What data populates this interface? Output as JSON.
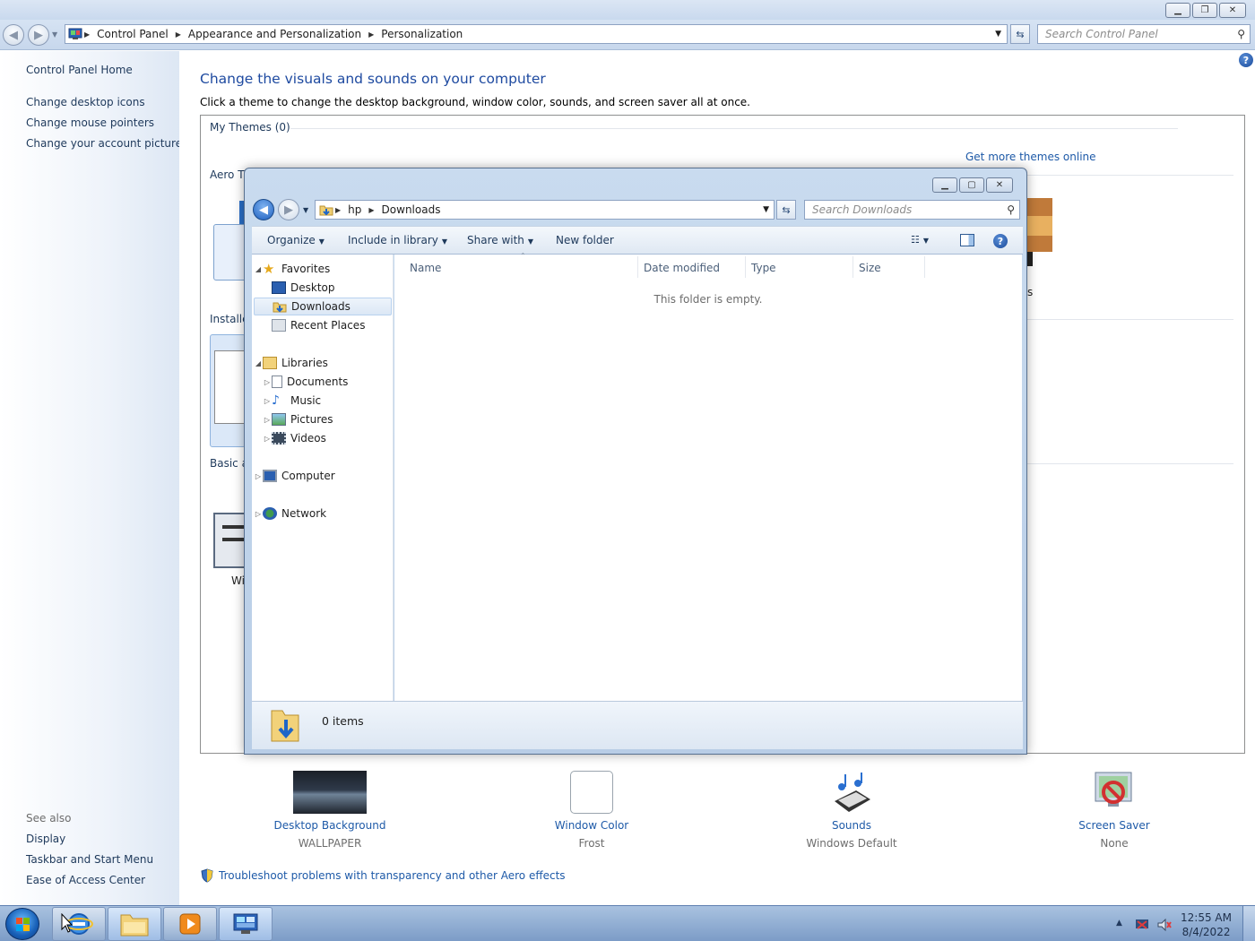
{
  "control_panel": {
    "address": {
      "crumbs": [
        "Control Panel",
        "Appearance and Personalization",
        "Personalization"
      ],
      "search_placeholder": "Search Control Panel"
    },
    "sidebar": {
      "home": "Control Panel Home",
      "links": [
        "Change desktop icons",
        "Change mouse pointers",
        "Change your account picture"
      ],
      "see_also_heading": "See also",
      "see_also": [
        "Display",
        "Taskbar and Start Menu",
        "Ease of Access Center"
      ]
    },
    "main": {
      "heading": "Change the visuals and sounds on your computer",
      "subheading": "Click a theme to change the desktop background, window color, sounds, and screen saver all at once.",
      "my_themes": "My Themes (0)",
      "get_more": "Get more themes online",
      "aero_label_partial": "Aero Th",
      "installed_label_partial": "Installe",
      "basic_label_partial": "Basic ar",
      "theme_caption_partial": "Wi",
      "right_fragment": "s"
    },
    "bottom_settings": [
      {
        "label": "Desktop Background",
        "value": "WALLPAPER"
      },
      {
        "label": "Window Color",
        "value": "Frost"
      },
      {
        "label": "Sounds",
        "value": "Windows Default"
      },
      {
        "label": "Screen Saver",
        "value": "None"
      }
    ],
    "troubleshoot": "Troubleshoot problems with transparency and other Aero effects"
  },
  "explorer": {
    "address": {
      "crumbs": [
        "hp",
        "Downloads"
      ],
      "search_placeholder": "Search Downloads"
    },
    "toolbar": {
      "organize": "Organize",
      "include": "Include in library",
      "share": "Share with",
      "new_folder": "New folder"
    },
    "nav": {
      "favorites": "Favorites",
      "desktop": "Desktop",
      "downloads": "Downloads",
      "recent": "Recent Places",
      "libraries": "Libraries",
      "documents": "Documents",
      "music": "Music",
      "pictures": "Pictures",
      "videos": "Videos",
      "computer": "Computer",
      "network": "Network"
    },
    "columns": [
      "Name",
      "Date modified",
      "Type",
      "Size"
    ],
    "empty_message": "This folder is empty.",
    "items_count": "0 items"
  },
  "taskbar": {
    "time": "12:55 AM",
    "date": "8/4/2022"
  },
  "colors": {
    "link": "#1e5aa8",
    "heading": "#1e4aa0",
    "taskbar": "#7c9cc7"
  }
}
